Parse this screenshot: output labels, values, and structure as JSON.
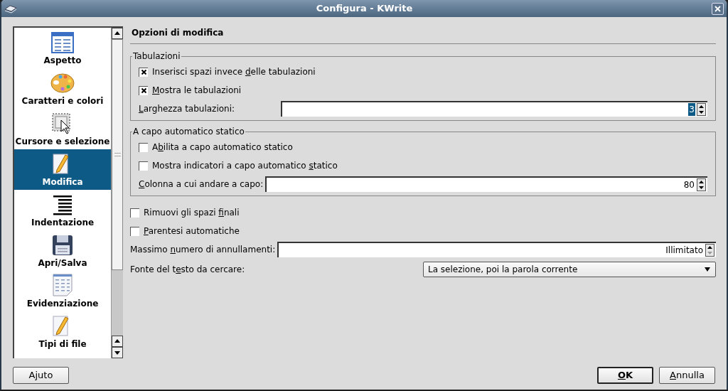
{
  "window": {
    "title": "Configura - KWrite"
  },
  "sidebar": {
    "items": [
      {
        "label": "Aspetto",
        "selected": false
      },
      {
        "label": "Caratteri e colori",
        "selected": false
      },
      {
        "label": "Cursore e selezione",
        "selected": false
      },
      {
        "label": "Modifica",
        "selected": true
      },
      {
        "label": "Indentazione",
        "selected": false
      },
      {
        "label": "Apri/Salva",
        "selected": false
      },
      {
        "label": "Evidenziazione",
        "selected": false
      },
      {
        "label": "Tipi di file",
        "selected": false
      }
    ]
  },
  "heading": "Opzioni di modifica",
  "groups": [
    {
      "title": "Tabulazioni",
      "rows": [
        {
          "kind": "checkbox",
          "label": {
            "before": "Inserisci spazi invece ",
            "key": "d",
            "after": "elle tabulazioni"
          },
          "checked": true
        },
        {
          "kind": "checkbox",
          "label": {
            "key": "M",
            "after": "ostra le tabulazioni"
          },
          "checked": true
        },
        {
          "kind": "spin",
          "label": {
            "key": "L",
            "after": "arghezza tabulazioni:"
          },
          "value": "3",
          "value_selected": true,
          "down_disabled": false
        }
      ]
    },
    {
      "title": "A capo automatico statico",
      "rows": [
        {
          "kind": "checkbox",
          "label": {
            "before": "A",
            "key": "b",
            "after": "ilita a capo automatico statico"
          },
          "checked": false
        },
        {
          "kind": "checkbox",
          "label": {
            "before": "Mostra indicatori a capo automatico ",
            "key": "s",
            "after": "tatico"
          },
          "checked": false
        },
        {
          "kind": "spin",
          "label": {
            "key": "C",
            "after": "olonna a cui andare a capo:"
          },
          "value": "80",
          "value_selected": false,
          "down_disabled": false
        }
      ]
    }
  ],
  "rows": [
    {
      "kind": "checkbox",
      "label": {
        "before": "Rimuovi gli spazi ",
        "key": "f",
        "after": "inali"
      },
      "checked": false
    },
    {
      "kind": "checkbox",
      "label": {
        "key": "P",
        "after": "arentesi automatiche"
      },
      "checked": false
    },
    {
      "kind": "spin",
      "label": {
        "before": "Massimo ",
        "key": "n",
        "after": "umero di annullamenti:"
      },
      "value": "Illimitato",
      "value_selected": false,
      "down_disabled": true
    },
    {
      "kind": "combo",
      "label": {
        "before": "Fonte del t",
        "key": "e",
        "after": "sto da cercare:"
      },
      "value": "La selezione, poi la parola corrente"
    }
  ],
  "help_button": {
    "label": {
      "before": "A",
      "key": "j",
      "after": "uto"
    },
    "default": false
  },
  "buttons": [
    {
      "label": {
        "key": "O",
        "after": "K"
      },
      "default": true
    },
    {
      "label": {
        "key": "A",
        "after": "nnulla"
      },
      "default": false
    }
  ]
}
